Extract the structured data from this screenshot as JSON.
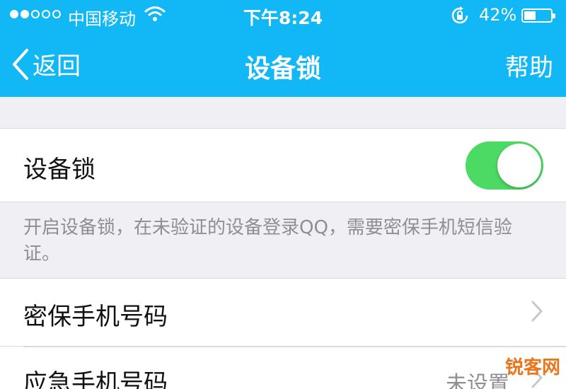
{
  "status_bar": {
    "carrier": "中国移动",
    "time": "下午8:24",
    "battery_percent": "42%",
    "signal_bars_filled": 2,
    "signal_bars_total": 5,
    "battery_level": 0.42
  },
  "nav": {
    "back_label": "返回",
    "title": "设备锁",
    "help_label": "帮助"
  },
  "device_lock": {
    "label": "设备锁",
    "enabled": true,
    "note": "开启设备锁，在未验证的设备登录QQ，需要密保手机短信验证。"
  },
  "rows": {
    "security_phone": {
      "label": "密保手机号码"
    },
    "emergency_phone": {
      "label": "应急手机号码",
      "value": "未设置"
    }
  },
  "watermark": "锐客网",
  "colors": {
    "header_bg": "#12b7f5",
    "toggle_on": "#4cd964",
    "page_bg": "#efeff4",
    "secondary_text": "#8e8e93",
    "watermark": "#e8761b"
  },
  "icons": [
    "wifi-icon",
    "rotation-lock-icon",
    "battery-icon",
    "back-chevron-icon",
    "chevron-right-icon"
  ]
}
